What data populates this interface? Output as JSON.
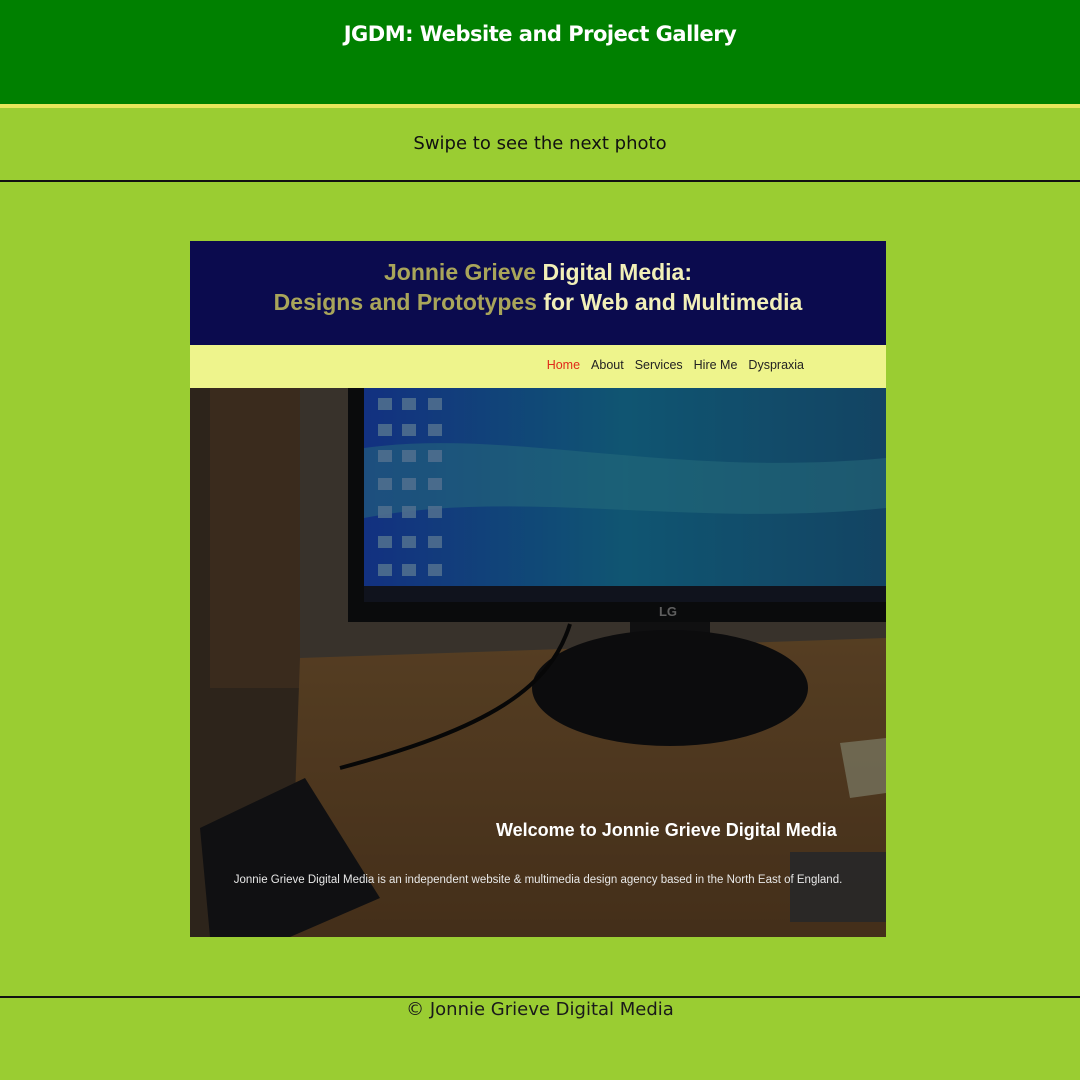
{
  "header": {
    "title": "JGDM: Website and Project Gallery"
  },
  "instruction": "Swipe to see the next photo",
  "slide": {
    "mock_site": {
      "title_line1_dim": "Jonnie Grieve",
      "title_line1_bright": "Digital Media:",
      "title_line2_dim": "Designs and Prototypes",
      "title_line2_bright": "for Web and Multimedia",
      "nav": [
        {
          "label": "Home",
          "active": true
        },
        {
          "label": "About",
          "active": false
        },
        {
          "label": "Services",
          "active": false
        },
        {
          "label": "Hire Me",
          "active": false
        },
        {
          "label": "Dyspraxia",
          "active": false
        }
      ],
      "hero_heading": "Welcome to Jonnie Grieve Digital Media",
      "hero_text": "Jonnie Grieve Digital Media is an independent website & multimedia design agency based in the North East of England.",
      "monitor_brand": "LG"
    }
  },
  "footer": {
    "text": "© Jonnie Grieve Digital Media"
  },
  "colors": {
    "page_bg": "#9acd32",
    "header_bg": "#008000",
    "header_border": "#e6e65a",
    "mock_header_bg": "#0b0b4e",
    "mock_nav_bg": "#eef48c",
    "nav_active": "#e02a1a"
  }
}
